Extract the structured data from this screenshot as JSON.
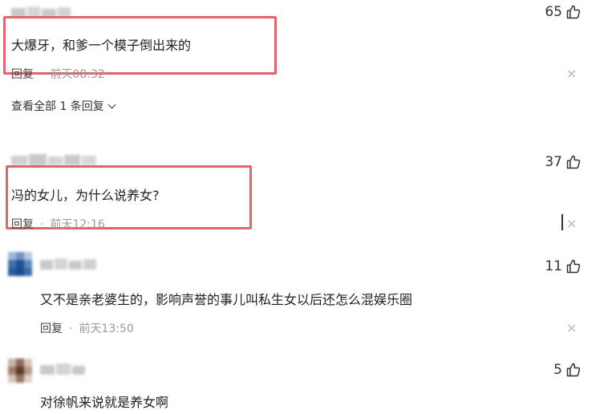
{
  "comments": [
    {
      "text": "大爆牙，和爹一个模子倒出来的",
      "likes": "65",
      "reply_label": "回复",
      "time": "前天08:32",
      "expand_label": "查看全部 1 条回复"
    },
    {
      "text": "冯的女儿，为什么说养女?",
      "likes": "37",
      "reply_label": "回复",
      "time": "前天12:16"
    },
    {
      "text": "又不是亲老婆生的，影响声誉的事儿叫私生女以后还怎么混娱乐圈",
      "likes": "11",
      "reply_label": "回复",
      "time": "前天13:50"
    },
    {
      "text": "对徐帆来说就是养女啊",
      "likes": "5"
    }
  ],
  "separator": "·",
  "close_glyph": "×",
  "colors": {
    "highlight_border": "#e0666b",
    "meta_gray": "#9a9a9a"
  },
  "icons": [
    "thumbs-up-icon",
    "close-icon",
    "chevron-down-icon"
  ]
}
